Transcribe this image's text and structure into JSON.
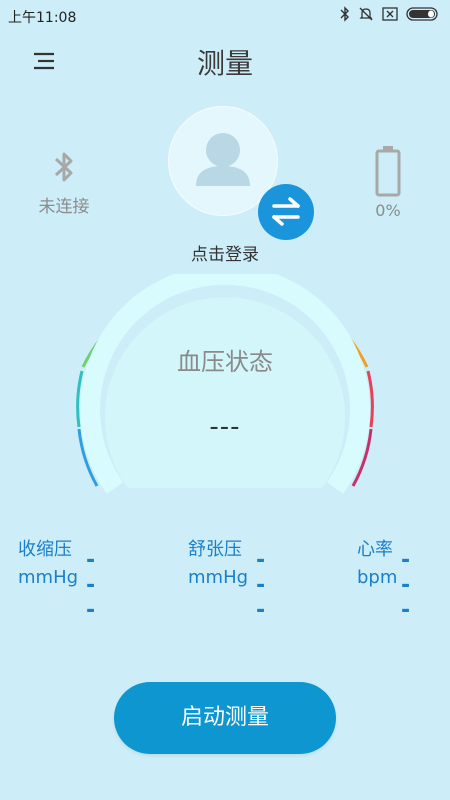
{
  "status_bar": {
    "time": "上午11:08"
  },
  "header": {
    "title": "测量"
  },
  "device": {
    "connection_label": "未连接",
    "battery_label": "0%"
  },
  "user": {
    "login_label": "点击登录"
  },
  "gauge": {
    "label": "血压状态",
    "value": "---"
  },
  "readings": {
    "systolic": {
      "name": "收缩压",
      "unit": "mmHg",
      "value": "---"
    },
    "diastolic": {
      "name": "舒张压",
      "unit": "mmHg",
      "value": "---"
    },
    "heart_rate": {
      "name": "心率",
      "unit": "bpm",
      "value": "---"
    }
  },
  "actions": {
    "start_label": "启动测量"
  },
  "colors": {
    "accent": "#0d96cf",
    "swap_button": "#1a95dc",
    "reading_text": "#1b7fc9",
    "background": "#cdeef8"
  },
  "icons": [
    "bluetooth-icon",
    "mute-icon",
    "sim-icon",
    "battery-icon",
    "menu-icon",
    "user-icon",
    "swap-icon"
  ]
}
